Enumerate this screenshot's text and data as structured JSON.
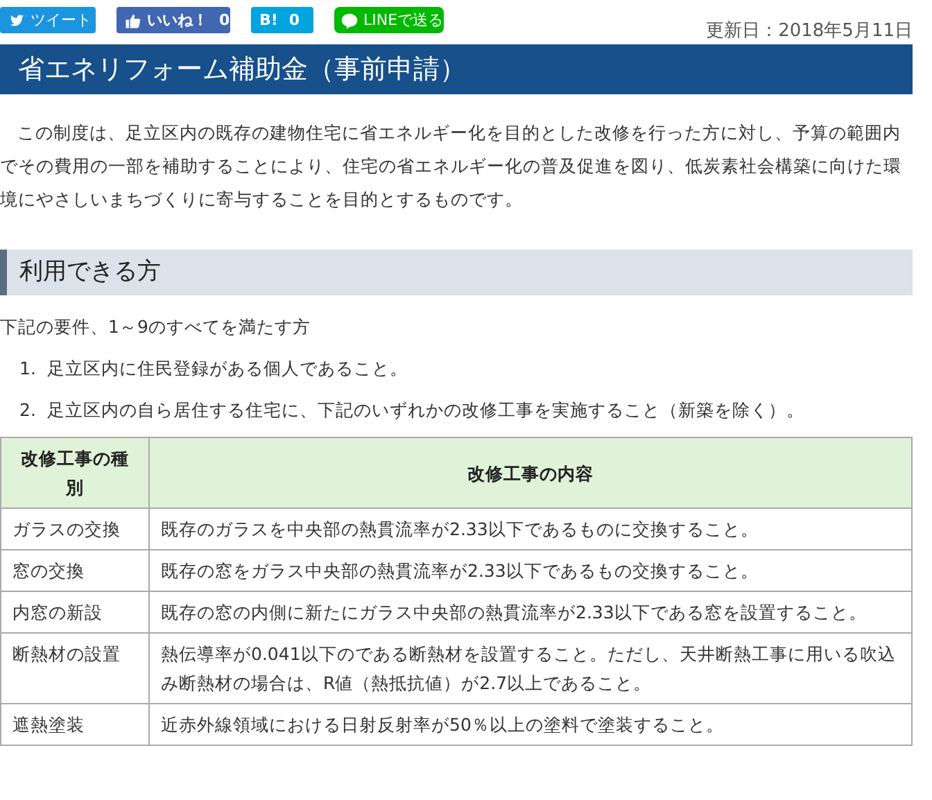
{
  "share_buttons": [
    {
      "kind": "twitter",
      "label": "ツイート"
    },
    {
      "kind": "facebook",
      "label": "いいね！",
      "count": "0"
    },
    {
      "kind": "hatena",
      "label": "B!",
      "count": "0"
    },
    {
      "kind": "line",
      "label": "LINEで送る"
    }
  ],
  "updated": "更新日：2018年5月11日",
  "title": "省エネリフォーム補助金（事前申請）",
  "intro": "この制度は、足立区内の既存の建物住宅に省エネルギー化を目的とした改修を行った方に対し、予算の範囲内でその費用の一部を補助することにより、住宅の省エネルギー化の普及促進を図り、低炭素社会構築に向けた環境にやさしいまちづくりに寄与することを目的とするものです。",
  "section": {
    "heading": "利用できる方",
    "lead": "下記の要件、1～9のすべてを満たす方",
    "requirements": [
      {
        "number": "1.",
        "text": "足立区内に住民登録がある個人であること。"
      },
      {
        "number": "2.",
        "text": "足立区内の自ら居住する住宅に、下記のいずれかの改修工事を実施すること（新築を除く）。"
      }
    ]
  },
  "table": {
    "columns": [
      "改修工事の種別",
      "改修工事の内容"
    ],
    "rows": [
      [
        "ガラスの交換",
        "既存のガラスを中央部の熱貫流率が2.33以下であるものに交換すること。"
      ],
      [
        "窓の交換",
        "既存の窓をガラス中央部の熱貫流率が2.33以下であるもの交換すること。"
      ],
      [
        "内窓の新設",
        "既存の窓の内側に新たにガラス中央部の熱貫流率が2.33以下である窓を設置すること。"
      ],
      [
        "断熱材の設置",
        "熱伝導率が0.041以下のである断熱材を設置すること。ただし、天井断熱工事に用いる吹込み断熱材の場合は、R値（熱抵抗値）が2.7以上であること。"
      ],
      [
        "遮熱塗装",
        "近赤外線領域における日射反射率が50％以上の塗料で塗装すること。"
      ]
    ]
  }
}
